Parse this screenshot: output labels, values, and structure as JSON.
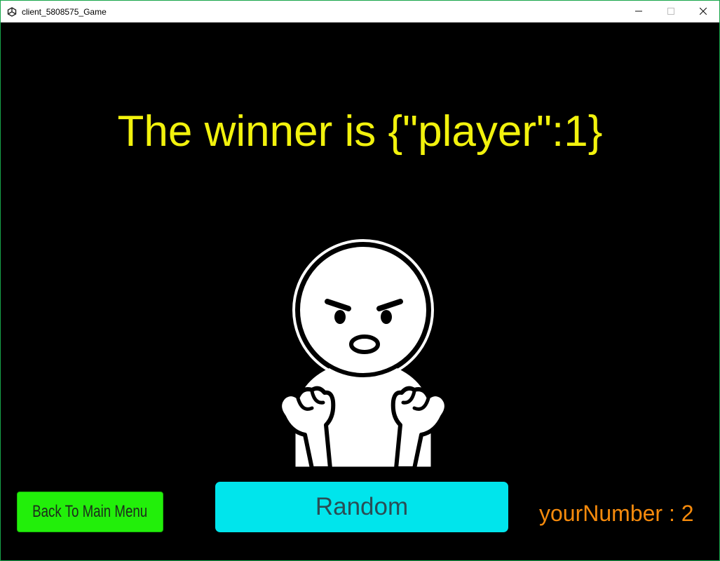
{
  "window": {
    "title": "client_5808575_Game",
    "app_icon": "unity-icon",
    "controls": [
      "minimize-icon",
      "maximize-icon",
      "close-icon"
    ]
  },
  "game": {
    "winner_text": "The winner is {\"player\":1}",
    "character": "angry-clenched-fists-character",
    "buttons": {
      "main_menu_label": "Back To Main Menu",
      "random_label": "Random"
    },
    "your_number_text": "yourNumber : 2"
  },
  "colors": {
    "background": "#000000",
    "winner_text": "#f2f20d",
    "main_menu_button": "#22ef0a",
    "random_button": "#00e5ec",
    "your_number_text": "#f58a0c"
  }
}
